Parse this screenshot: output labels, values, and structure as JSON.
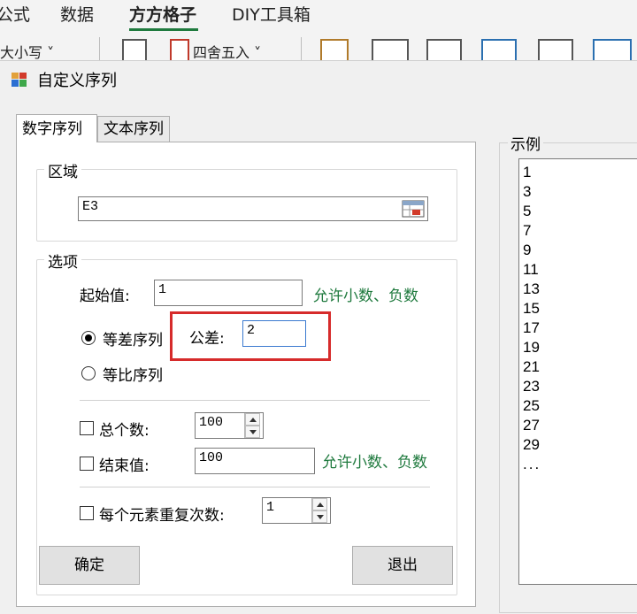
{
  "ribbon": {
    "tabs": [
      "公式",
      "数据",
      "方方格子",
      "DIY工具箱"
    ],
    "tools": [
      "大小写 ˅",
      "四舍五入 ˅"
    ]
  },
  "dialog": {
    "title": "自定义序列",
    "tabs": [
      "数字序列",
      "文本序列"
    ],
    "region": {
      "title": "区域",
      "value": "E3"
    },
    "options": {
      "title": "选项",
      "start_label": "起始值:",
      "start_value": "1",
      "allow_hint": "允许小数、负数",
      "arith_label": "等差序列",
      "diff_label": "公差:",
      "diff_value": "2",
      "geo_label": "等比序列",
      "total_label": "总个数:",
      "total_value": "100",
      "end_label": "结束值:",
      "end_value": "100",
      "end_hint": "允许小数、负数",
      "repeat_label": "每个元素重复次数:",
      "repeat_value": "1"
    },
    "buttons": {
      "ok": "确定",
      "exit": "退出"
    },
    "example": {
      "title": "示例",
      "items": [
        "1",
        "3",
        "5",
        "7",
        "9",
        "11",
        "13",
        "15",
        "17",
        "19",
        "21",
        "23",
        "25",
        "27",
        "29",
        "..."
      ]
    }
  },
  "colors": {
    "accent_green": "#1f7a3e",
    "highlight_red": "#d62b2b"
  }
}
